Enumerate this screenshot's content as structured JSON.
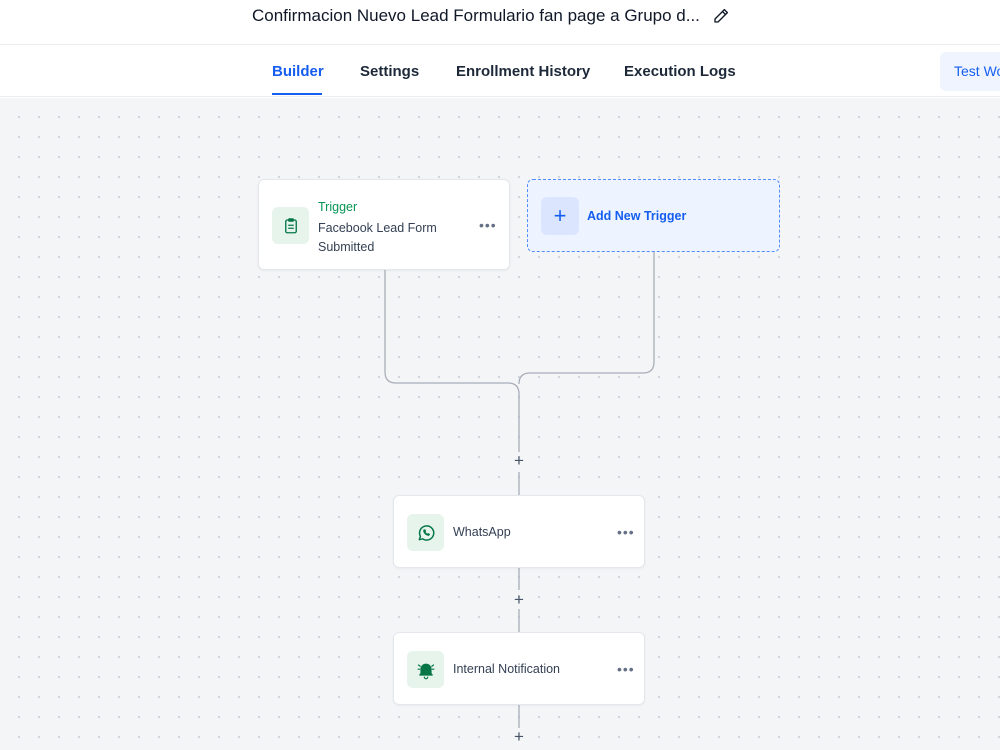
{
  "header": {
    "title": "Confirmacion Nuevo Lead Formulario fan page a Grupo d...",
    "edit_icon": "pencil-icon"
  },
  "tabs": [
    {
      "label": "Builder",
      "active": true
    },
    {
      "label": "Settings",
      "active": false
    },
    {
      "label": "Enrollment History",
      "active": false
    },
    {
      "label": "Execution Logs",
      "active": false
    }
  ],
  "test_button": {
    "label": "Test Wo"
  },
  "workflow": {
    "trigger": {
      "label": "Trigger",
      "description": "Facebook Lead Form Submitted",
      "icon": "clipboard-icon"
    },
    "add_trigger": {
      "label": "Add New Trigger",
      "icon": "plus-icon"
    },
    "actions": [
      {
        "label": "WhatsApp",
        "icon": "whatsapp-icon"
      },
      {
        "label": "Internal Notification",
        "icon": "bell-icon"
      }
    ],
    "menu_icon": "ellipsis-icon",
    "add_step_symbol": "+"
  },
  "colors": {
    "accent": "#155eef",
    "trigger_green": "#079455",
    "icon_bg": "#e6f4ec",
    "canvas_bg": "#f4f5f7"
  }
}
